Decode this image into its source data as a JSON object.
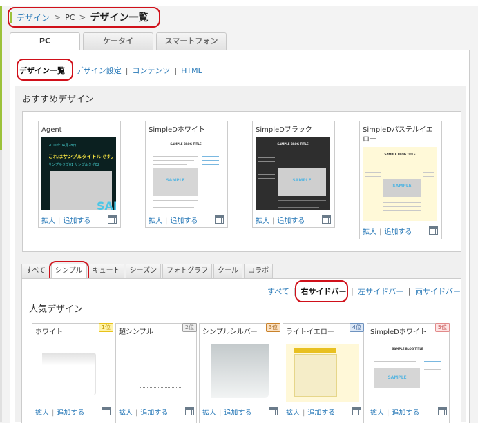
{
  "breadcrumb": {
    "root": "デザイン",
    "sep1": ">",
    "pc": "PC",
    "sep2": ">",
    "current": "デザイン一覧"
  },
  "main_tabs": [
    {
      "label": "PC",
      "active": true
    },
    {
      "label": "ケータイ",
      "active": false
    },
    {
      "label": "スマートフォン",
      "active": false
    }
  ],
  "subnav": {
    "current": "デザイン一覧",
    "links": [
      "デザイン設定",
      "コンテンツ",
      "HTML"
    ],
    "sep": "|"
  },
  "recommended": {
    "title": "おすすめデザイン",
    "cards": [
      {
        "name": "Agent",
        "thumb_texts": {
          "date": "2010年04月28日",
          "title": "これはサンプルタイトルです。",
          "tags": "サンプルタグ01  サンプルタグ02",
          "sample": "SAI"
        }
      },
      {
        "name": "SimpleDホワイト",
        "thumb_texts": {
          "blog": "SAMPLE BLOG TITLE",
          "sample": "SAMPLE"
        }
      },
      {
        "name": "SimpleDブラック",
        "thumb_texts": {
          "blog": "SAMPLE BLOG TITLE",
          "sample": "SAMPLE"
        }
      },
      {
        "name": "SimpleDパステルイエロー",
        "thumb_texts": {
          "blog": "SAMPLE BLOG TITLE",
          "sample": "SAMPLE"
        }
      }
    ],
    "actions": {
      "enlarge": "拡大",
      "sep": "|",
      "add": "追加する"
    }
  },
  "filter_tabs": [
    {
      "label": "すべて",
      "active": false
    },
    {
      "label": "シンプル",
      "active": true
    },
    {
      "label": "キュート",
      "active": false
    },
    {
      "label": "シーズン",
      "active": false
    },
    {
      "label": "フォトグラフ",
      "active": false
    },
    {
      "label": "クール",
      "active": false
    },
    {
      "label": "コラボ",
      "active": false
    }
  ],
  "side_filter": {
    "all": "すべて",
    "right": "右サイドバー",
    "left": "左サイドバー",
    "both": "両サイドバー",
    "sep": "|"
  },
  "popular": {
    "title": "人気デザイン",
    "cards": [
      {
        "name": "ホワイト",
        "rank": "1位",
        "rank_color": "#e8c21a"
      },
      {
        "name": "超シンプル",
        "rank": "2位",
        "rank_color": "#a0a0a0"
      },
      {
        "name": "シンプルシルバー",
        "rank": "3位",
        "rank_color": "#c9822b"
      },
      {
        "name": "ライトイエロー",
        "rank": "4位",
        "rank_color": "#6f93c0"
      },
      {
        "name": "SimpleDホワイト",
        "rank": "5位",
        "rank_color": "#e28a8a"
      }
    ],
    "actions": {
      "enlarge": "拡大",
      "sep": "|",
      "add": "追加する"
    },
    "thumb_texts": {
      "blog": "SAMPLE BLOG TITLE",
      "sample": "SAMPLE"
    }
  },
  "colors": {
    "link": "#2a7ab8",
    "highlight": "#d0101a",
    "brand_green": "#9cc23a"
  },
  "icons": [
    "layout-icon"
  ]
}
